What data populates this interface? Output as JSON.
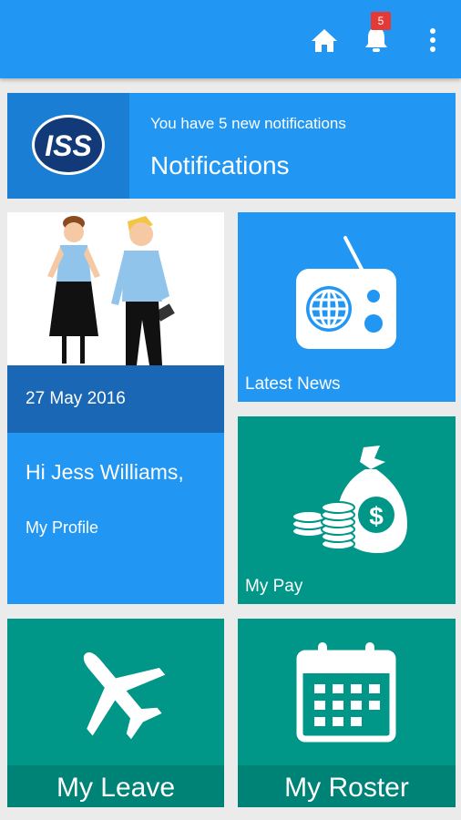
{
  "app_bar": {
    "notification_count": "5",
    "icons": [
      "home-icon",
      "bell-icon",
      "more-vert-icon"
    ]
  },
  "notifications_tile": {
    "logo_text": "ISS",
    "subtitle": "You have 5 new notifications",
    "title": "Notifications"
  },
  "profile_tile": {
    "date": "27 May 2016",
    "greeting": "Hi Jess Williams,",
    "link": "My Profile"
  },
  "news_tile": {
    "label": "Latest News",
    "icon": "radio-icon"
  },
  "pay_tile": {
    "label": "My Pay",
    "icon": "money-bag-icon"
  },
  "leave_tile": {
    "label": "My Leave",
    "icon": "airplane-icon"
  },
  "roster_tile": {
    "label": "My Roster",
    "icon": "calendar-icon"
  },
  "colors": {
    "app_bar": "#2196f3",
    "tile_blue": "#2196f3",
    "tile_teal": "#009688",
    "badge": "#e53935",
    "date_bar": "#1a67b5"
  }
}
